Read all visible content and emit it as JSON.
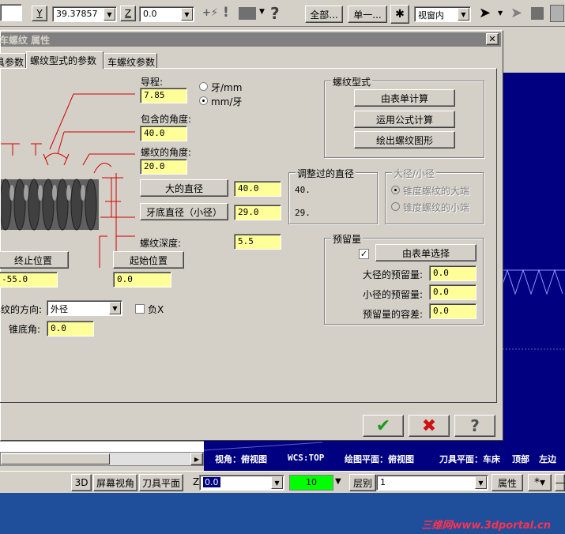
{
  "colors": {
    "viewport": "#000080",
    "field_yellow": "#ffff99",
    "dialog_title": "#808080",
    "chrome": "#d4d0c8",
    "ok_green": "#1a9a1a",
    "cancel_red": "#d01010"
  },
  "toolbar": {
    "y_label": "Y",
    "y_value": "39.37857",
    "z_label": "Z",
    "z_value": "0.0",
    "all_button": "全部...",
    "single_button": "单一...",
    "view_select": "视窗内"
  },
  "dialog": {
    "title": "车螺纹 属性",
    "tabs": [
      "刀具参数",
      "螺纹型式的参数",
      "车螺纹参数"
    ],
    "lead_label": "导程:",
    "unit_options": [
      "牙/mm",
      "mm/牙"
    ],
    "lead_value": "7.85",
    "included_angle_label": "包含的角度:",
    "included_angle_value": "40.0",
    "thread_angle_label": "螺纹的角度:",
    "thread_angle_value": "20.0",
    "major_dia_button": "大的直径",
    "major_dia_value": "40.0",
    "minor_dia_button": "牙底直径（小径）",
    "minor_dia_value": "29.0",
    "depth_label": "螺纹深度:",
    "depth_value": "5.5",
    "end_pos_button": "终止位置",
    "end_pos_value": "-55.0",
    "start_pos_button": "起始位置",
    "start_pos_value": "0.0",
    "direction_label": "螺纹的方向:",
    "direction_value": "外径",
    "negative_x_label": "负X",
    "taper_label": "锥底角:",
    "taper_value": "0.0",
    "thread_form": {
      "title": "螺纹型式",
      "buttons": [
        "由表单计算",
        "运用公式计算",
        "绘出螺纹图形"
      ]
    },
    "adjusted_dia": {
      "title": "调整过的直径",
      "value1": "40.",
      "value2": "29."
    },
    "major_minor": {
      "title": "大径/小径",
      "options": [
        "锥度螺纹的大端",
        "锥度螺纹的小端"
      ]
    },
    "allowance": {
      "title": "预留量",
      "select_button": "由表单选择",
      "major_label": "大径的预留量:",
      "major_value": "0.0",
      "minor_label": "小径的预留量:",
      "minor_value": "0.0",
      "tolerance_label": "预留量的容差:",
      "tolerance_value": "0.0"
    }
  },
  "statusbar": {
    "line1": [
      "视角：俯视图",
      "WCS:TOP",
      "绘图平面：俯视图",
      "刀具平面：车床",
      "顶部",
      "左边"
    ],
    "btn_3d": "3D",
    "btn_screen_view": "屏幕视角",
    "btn_tool_plane": "刀具平面",
    "z_label": "Z",
    "z_value": "0.0",
    "color_value": "10",
    "layer_label": "层别",
    "layer_value": "1",
    "attr_button": "属性",
    "watermark": "三维网www.3dportal.cn"
  }
}
